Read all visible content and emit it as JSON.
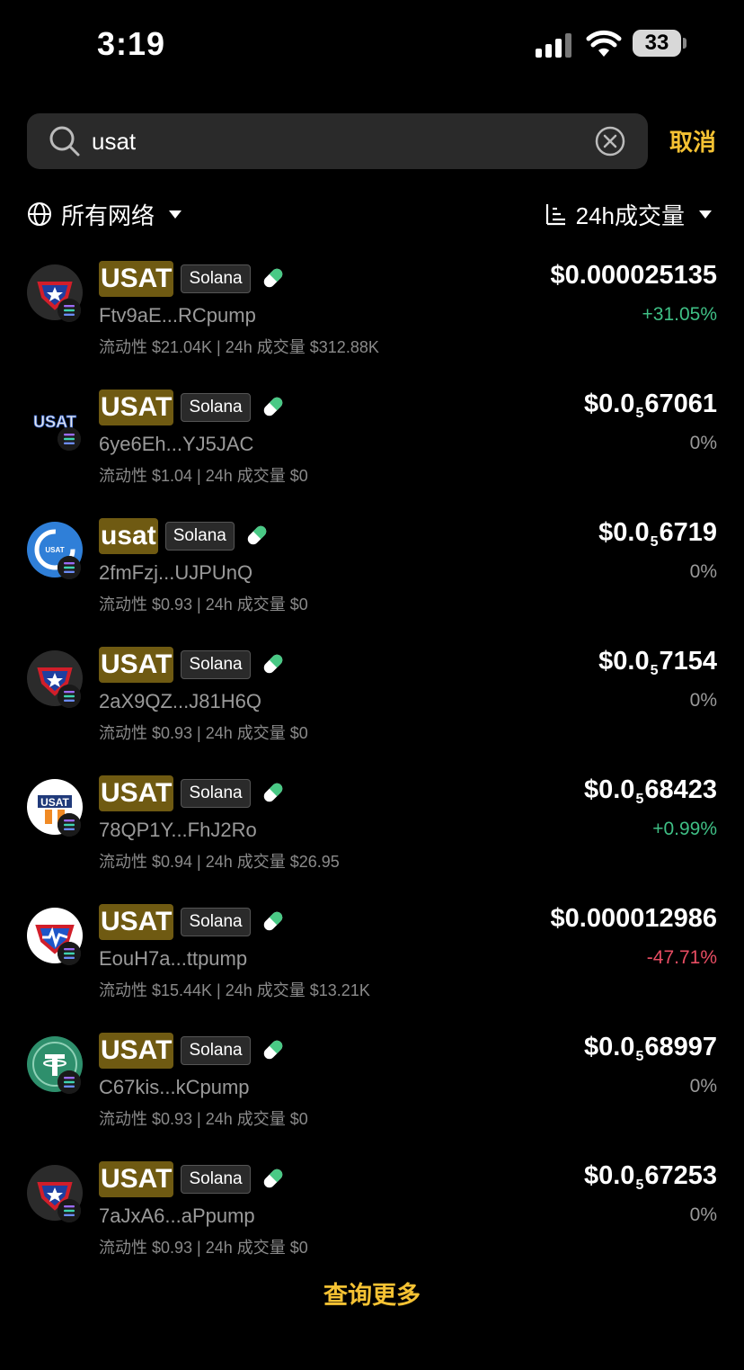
{
  "status_bar": {
    "time": "3:19",
    "battery": "33"
  },
  "search": {
    "value": "usat",
    "cancel_label": "取消"
  },
  "filters": {
    "network_label": "所有网络",
    "sort_label": "24h成交量"
  },
  "colors": {
    "accent": "#f5c233",
    "up": "#3fbf85",
    "down": "#e84d63",
    "symbol_bg": "#6f5a12"
  },
  "tokens": [
    {
      "symbol": "USAT",
      "network": "Solana",
      "address": "Ftv9aE...RCpump",
      "meta": "流动性 $21.04K | 24h 成交量 $312.88K",
      "price_prefix": "$0.000025135",
      "price_sub": "",
      "price_suffix": "",
      "change": "+31.05%",
      "trend": "up",
      "logo": "shield-star"
    },
    {
      "symbol": "USAT",
      "network": "Solana",
      "address": "6ye6Eh...YJ5JAC",
      "meta": "流动性 $1.04 | 24h 成交量 $0",
      "price_prefix": "$0.0",
      "price_sub": "5",
      "price_suffix": "67061",
      "change": "0%",
      "trend": "flat",
      "logo": "text-usat"
    },
    {
      "symbol": "usat",
      "network": "Solana",
      "address": "2fmFzj...UJPUnQ",
      "meta": "流动性 $0.93 | 24h 成交量 $0",
      "price_prefix": "$0.0",
      "price_sub": "5",
      "price_suffix": "6719",
      "change": "0%",
      "trend": "flat",
      "logo": "blue-circle"
    },
    {
      "symbol": "USAT",
      "network": "Solana",
      "address": "2aX9QZ...J81H6Q",
      "meta": "流动性 $0.93 | 24h 成交量 $0",
      "price_prefix": "$0.0",
      "price_sub": "5",
      "price_suffix": "7154",
      "change": "0%",
      "trend": "flat",
      "logo": "shield-star"
    },
    {
      "symbol": "USAT",
      "network": "Solana",
      "address": "78QP1Y...FhJ2Ro",
      "meta": "流动性 $0.94 | 24h 成交量 $26.95",
      "price_prefix": "$0.0",
      "price_sub": "5",
      "price_suffix": "68423",
      "change": "+0.99%",
      "trend": "up",
      "logo": "usat-flag"
    },
    {
      "symbol": "USAT",
      "network": "Solana",
      "address": "EouH7a...ttpump",
      "meta": "流动性 $15.44K | 24h 成交量 $13.21K",
      "price_prefix": "$0.000012986",
      "price_sub": "",
      "price_suffix": "",
      "change": "-47.71%",
      "trend": "down",
      "logo": "shield-pulse"
    },
    {
      "symbol": "USAT",
      "network": "Solana",
      "address": "C67kis...kCpump",
      "meta": "流动性 $0.93 | 24h 成交量 $0",
      "price_prefix": "$0.0",
      "price_sub": "5",
      "price_suffix": "68997",
      "change": "0%",
      "trend": "flat",
      "logo": "tether-coin"
    },
    {
      "symbol": "USAT",
      "network": "Solana",
      "address": "7aJxA6...aPpump",
      "meta": "流动性 $0.93 | 24h 成交量 $0",
      "price_prefix": "$0.0",
      "price_sub": "5",
      "price_suffix": "67253",
      "change": "0%",
      "trend": "flat",
      "logo": "shield-star"
    }
  ],
  "more_label": "查询更多"
}
